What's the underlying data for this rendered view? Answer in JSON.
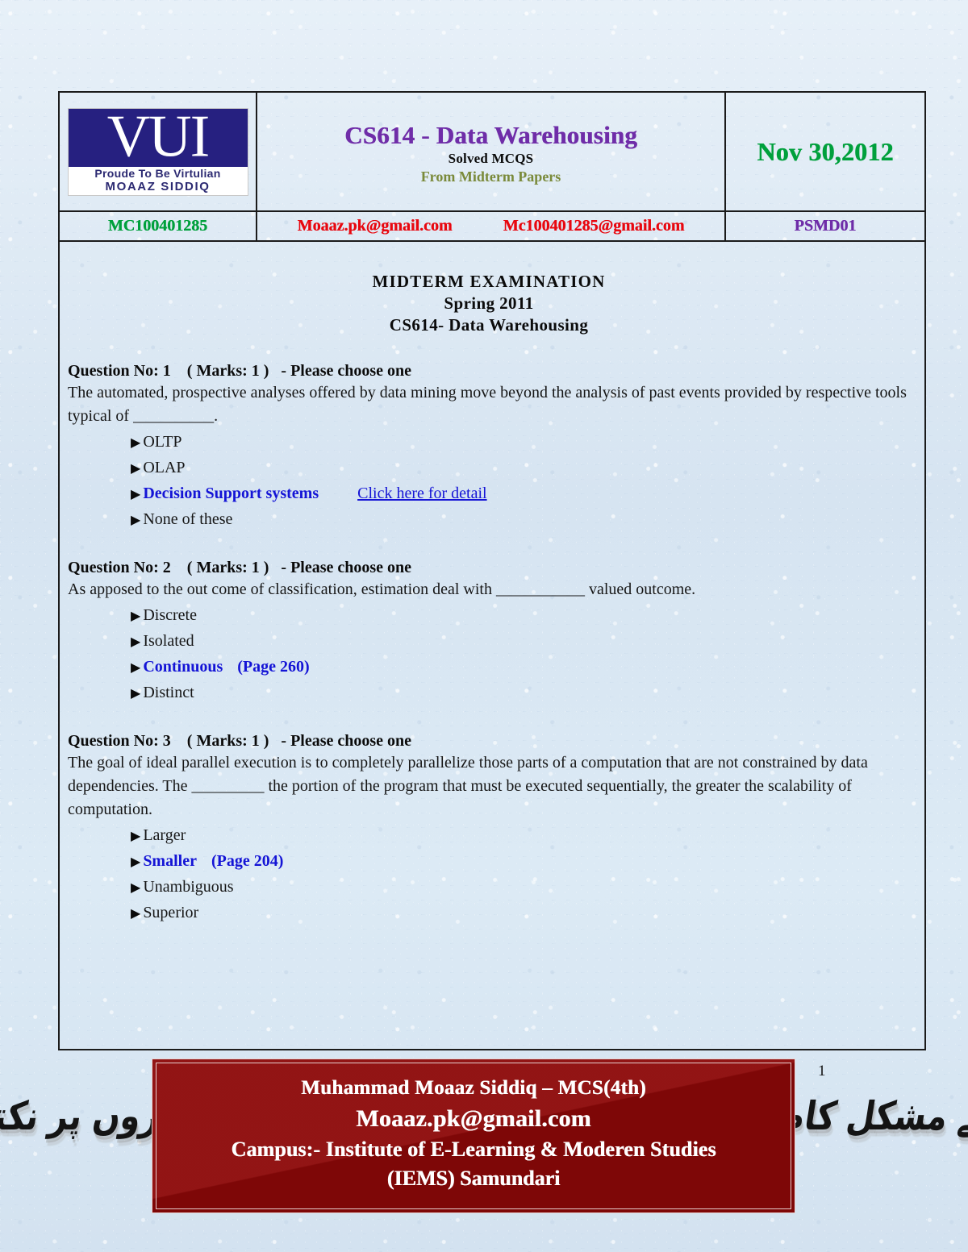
{
  "header": {
    "logo": {
      "letters": "VUI",
      "tagline1": "Proude To Be Virtulian",
      "tagline2": "MOAAZ SIDDIQ",
      "brand_color": "#262080"
    },
    "course_title": "CS614 - Data Warehousing",
    "subtitle": "Solved MCQS",
    "source": "From Midterm Papers",
    "date": "Nov 30,2012",
    "colors": {
      "course_title": "#6f2da8",
      "source": "#7a8a3a",
      "date": "#00a03c"
    }
  },
  "info_row": {
    "student_id": "MC100401285",
    "email_primary": "Moaaz.pk@gmail.com",
    "email_secondary": "Mc100401285@gmail.com",
    "paper_code": "PSMD01",
    "colors": {
      "student_id": "#00a03c",
      "emails": "#e8070f",
      "paper_code": "#6f2da8"
    }
  },
  "exam": {
    "line1": "MIDTERM  EXAMINATION",
    "line2": "Spring 2011",
    "line3": "CS614- Data Warehousing"
  },
  "questions": [
    {
      "header": "Question No: 1    ( Marks: 1 )   - Please choose one",
      "text": "The automated, prospective analyses offered by data mining move beyond the analysis of past events provided by respective tools typical of __________.",
      "options": [
        {
          "label": "OLTP",
          "correct": false,
          "page_ref": "",
          "link": ""
        },
        {
          "label": "OLAP",
          "correct": false,
          "page_ref": "",
          "link": ""
        },
        {
          "label": "Decision Support systems",
          "correct": true,
          "page_ref": "",
          "link": "Click here for detail"
        },
        {
          "label": "None of these",
          "correct": false,
          "page_ref": "",
          "link": ""
        }
      ]
    },
    {
      "header": "Question No: 2    ( Marks: 1 )   - Please choose one",
      "text": "As apposed to the out come of classification, estimation deal with ___________ valued outcome.",
      "options": [
        {
          "label": "Discrete",
          "correct": false,
          "page_ref": "",
          "link": ""
        },
        {
          "label": "Isolated",
          "correct": false,
          "page_ref": "",
          "link": ""
        },
        {
          "label": "Continuous",
          "correct": true,
          "page_ref": "(Page 260)",
          "link": ""
        },
        {
          "label": "Distinct",
          "correct": false,
          "page_ref": "",
          "link": ""
        }
      ]
    },
    {
      "header": "Question No: 3    ( Marks: 1 )   - Please choose one",
      "text": "The goal of ideal parallel execution is to completely parallelize those parts of a computation that are not constrained by data dependencies. The _________ the portion of the program that must be executed sequentially, the greater the scalability of computation.",
      "options": [
        {
          "label": "Larger",
          "correct": false,
          "page_ref": "",
          "link": ""
        },
        {
          "label": "Smaller",
          "correct": true,
          "page_ref": "(Page 204)",
          "link": ""
        },
        {
          "label": "Unambiguous",
          "correct": false,
          "page_ref": "",
          "link": ""
        },
        {
          "label": "Superior",
          "correct": false,
          "page_ref": "",
          "link": ""
        }
      ]
    }
  ],
  "urdu_quote": "دنیا میں سب سے مشکل کام اپنی اصلاح اور سب سے آسان کام دوسروں پر نکتہ چینی کرنا ہے",
  "page_number": "1",
  "footer": {
    "name": "Muhammad Moaaz Siddiq – MCS(4th)",
    "email": "Moaaz.pk@gmail.com",
    "campus": "Campus:- Institute of E-Learning & Moderen Studies",
    "institute": "(IEMS) Samundari",
    "background_color": "#8c0808"
  }
}
